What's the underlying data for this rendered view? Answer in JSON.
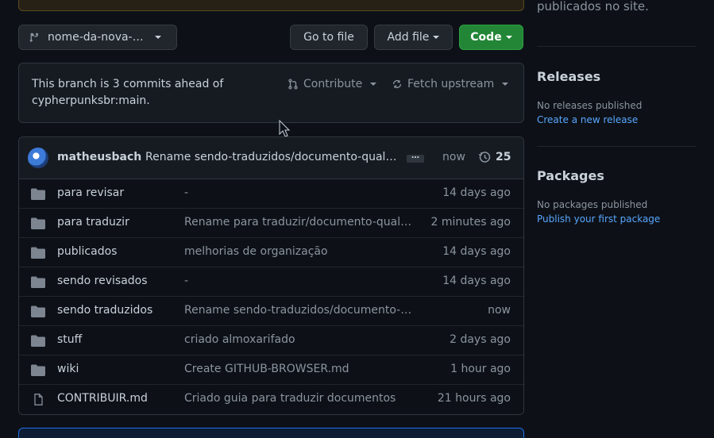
{
  "toolbar": {
    "branch_label": "nome-da-nova-…",
    "go_to_file": "Go to file",
    "add_file": "Add file",
    "code": "Code"
  },
  "ahead": {
    "text_line1": "This branch is 3 commits ahead of",
    "text_line2": "cypherpunksbr:main.",
    "contribute": "Contribute",
    "fetch_upstream": "Fetch upstream"
  },
  "commit": {
    "author": "matheusbach",
    "message": "Rename sendo-traduzidos/documento-qualquer.md",
    "time": "now",
    "count": "25"
  },
  "files": [
    {
      "name": "para revisar",
      "type": "folder",
      "message": "-",
      "time": "14 days ago"
    },
    {
      "name": "para traduzir",
      "type": "folder",
      "message": "Rename para traduzir/documento-qualquer.md",
      "time": "2 minutes ago"
    },
    {
      "name": "publicados",
      "type": "folder",
      "message": "melhorias de organização",
      "time": "14 days ago"
    },
    {
      "name": "sendo revisados",
      "type": "folder",
      "message": "-",
      "time": "14 days ago"
    },
    {
      "name": "sendo traduzidos",
      "type": "folder",
      "message": "Rename sendo-traduzidos/documento-qualquer.md",
      "time": "now"
    },
    {
      "name": "stuff",
      "type": "folder",
      "message": "criado almoxarifado",
      "time": "2 days ago"
    },
    {
      "name": "wiki",
      "type": "folder",
      "message": "Create GITHUB-BROWSER.md",
      "time": "1 hour ago"
    },
    {
      "name": "CONTRIBUIR.md",
      "type": "file",
      "message": "Criado guia para traduzir documentos",
      "time": "21 hours ago"
    }
  ],
  "sidebar": {
    "top_text": "publicados no site.",
    "releases_title": "Releases",
    "releases_none": "No releases published",
    "releases_link": "Create a new release",
    "packages_title": "Packages",
    "packages_none": "No packages published",
    "packages_link": "Publish your first package"
  },
  "colors": {
    "background": "#0d1117",
    "surface": "#161b22",
    "border": "#30363d",
    "link": "#58a6ff",
    "code_button": "#238636"
  },
  "icons": {
    "branch": "git-branch-icon",
    "contribute": "git-pull-request-icon",
    "fetch": "sync-icon",
    "history": "history-icon",
    "folder": "folder-icon",
    "file": "file-icon"
  }
}
